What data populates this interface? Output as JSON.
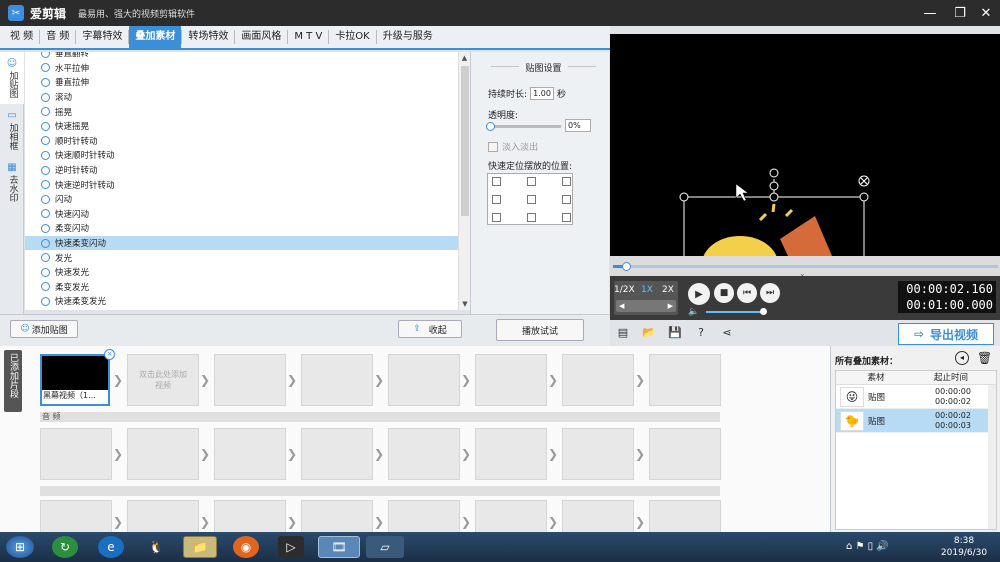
{
  "app": {
    "name": "爱剪辑",
    "slogan": "最易用、强大的视频剪辑软件"
  },
  "window_controls": {
    "minimize": "—",
    "restore": "❐",
    "close": "✕"
  },
  "tabs": [
    "视 频",
    "音 频",
    "字幕特效",
    "叠加素材",
    "转场特效",
    "画面风格",
    "M T V",
    "卡拉OK",
    "升级与服务"
  ],
  "active_tab": "叠加素材",
  "side_tabs": [
    {
      "label": "加贴图",
      "icon": "☺"
    },
    {
      "label": "加相框",
      "icon": "▭"
    },
    {
      "label": "去水印",
      "icon": "▦"
    }
  ],
  "effects": {
    "items": [
      "垂直翻转",
      "水平拉伸",
      "垂直拉伸",
      "滚动",
      "摇晃",
      "快速摇晃",
      "顺时针转动",
      "快速顺时针转动",
      "逆时针转动",
      "快速逆时针转动",
      "闪动",
      "快速闪动",
      "柔变闪动",
      "快速柔变闪动",
      "发光",
      "快速发光",
      "柔变发光",
      "快速柔变发光"
    ],
    "selected_index": 13
  },
  "sticker_settings": {
    "title": "贴图设置",
    "duration_label": "持续时长:",
    "duration_value": "1.00",
    "duration_unit": "秒",
    "opacity_label": "透明度:",
    "opacity_value": "0%",
    "fade_label": "淡入淡出",
    "position_label": "快速定位摆放的位置:"
  },
  "buttons": {
    "add_sticker": "添加贴图",
    "collapse": "收起",
    "preview_play": "播放试试",
    "export": "导出视频"
  },
  "player": {
    "rates": [
      "1/2X",
      "1X",
      "2X"
    ],
    "active_rate": "1X",
    "current_time": "00:00:02.160",
    "total_time": "00:01:00.000",
    "playhead_fraction": 0.035
  },
  "timeline": {
    "added_label": "已添加片段",
    "clip_name": "黑幕视频（1...",
    "placeholder": "双击此处添加视频",
    "audio_label": "音 频"
  },
  "materials": {
    "title": "所有叠加素材：",
    "col_material": "素材",
    "col_time": "起止时间",
    "rows": [
      {
        "name": "贴图",
        "start": "00:00:00",
        "end": "00:00:02",
        "icon": "😜"
      },
      {
        "name": "贴图",
        "start": "00:00:02",
        "end": "00:00:03",
        "icon": "🐤"
      }
    ],
    "selected_index": 1
  },
  "taskbar": {
    "time": "8:38",
    "date": "2019/6/30"
  },
  "colors": {
    "accent": "#3b8fd9",
    "titlebar": "#2c2c2c",
    "selected_row": "#b7dbf5"
  }
}
